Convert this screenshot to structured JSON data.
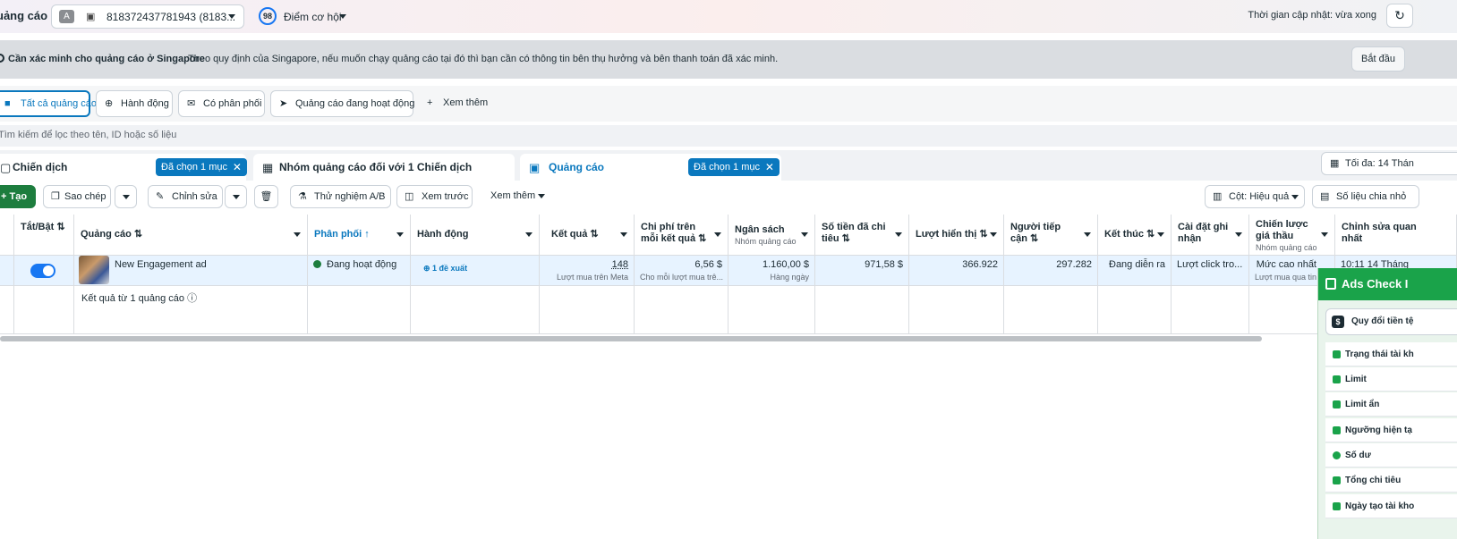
{
  "topbar": {
    "title": "uảng cáo",
    "account_badge": "A",
    "account_text": "818372437781943 (8183...",
    "opportunity_score": "98",
    "opportunity_label": "Điểm cơ hội",
    "updated": "Thời gian cập nhật: vừa xong"
  },
  "banner": {
    "title": "Cần xác minh cho quảng cáo ở Singapore",
    "text": "Theo quy định của Singapore, nếu muốn chạy quảng cáo tại đó thì bạn cần có thông tin bên thụ hưởng và bên thanh toán đã xác minh.",
    "button": "Bắt đầu"
  },
  "chips": [
    "Tất cả quảng cáo",
    "Hành động",
    "Có phân phối",
    "Quảng cáo đang hoạt động",
    "Xem thêm"
  ],
  "search": {
    "placeholder": "Tìm kiếm để lọc theo tên, ID hoặc số liệu"
  },
  "tabs": {
    "campaign": "Chiến dịch",
    "adset": "Nhóm quảng cáo đối với 1 Chiến dịch",
    "ad": "Quảng cáo",
    "selected": "Đã chọn 1 mục",
    "date": "Tối đa: 14 Thán"
  },
  "toolbar": {
    "create": "Tạo",
    "copy": "Sao chép",
    "edit": "Chỉnh sửa",
    "ab_test": "Thử nghiệm A/B",
    "preview": "Xem trước",
    "more": "Xem thêm",
    "columns": "Cột: Hiệu quả",
    "breakdown": "Số liệu chia nhỏ"
  },
  "table": {
    "headers": {
      "toggle": "Tắt/Bật ⇅",
      "ad": "Quảng cáo ⇅",
      "delivery": "Phân phối ↑",
      "actions": "Hành động",
      "results": "Kết quả ⇅",
      "cost": "Chi phí trên mỗi kết quả ⇅",
      "budget": "Ngân sách",
      "budget_sub": "Nhóm quảng cáo",
      "spent": "Số tiền đã chi tiêu ⇅",
      "impressions": "Lượt hiển thị ⇅",
      "reach": "Người tiếp cận ⇅",
      "end": "Kết thúc ⇅",
      "attribution": "Cài đặt ghi nhận",
      "bid": "Chiến lược giá thầu",
      "bid_sub": "Nhóm quảng cáo",
      "last_edit": "Chỉnh sửa quan nhất"
    },
    "row": {
      "ad_name": "New Engagement ad",
      "delivery": "Đang hoạt động",
      "actions": "1 đề xuất",
      "results": "148",
      "results_sub": "Lượt mua trên Meta",
      "cost": "6,56 $",
      "cost_sub": "Cho mỗi lượt mua trê...",
      "budget": "1.160,00 $",
      "budget_sub": "Hàng ngày",
      "spent": "971,58 $",
      "impressions": "366.922",
      "reach": "297.282",
      "end": "Đang diễn ra",
      "attribution": "Lượt click tro...",
      "bid": "Mức cao nhất",
      "bid_sub": "Lượt mua qua tin",
      "last_edit": "10:11 14 Tháng"
    },
    "summary": "Kết quả từ 1 quảng cáo"
  },
  "panel": {
    "title": "Ads Check I",
    "conversion": "Quy đổi tiền tệ",
    "rows": [
      "Trạng thái tài kh",
      "Limit",
      "Limit ẩn",
      "Ngưỡng hiện tạ",
      "Số dư",
      "Tổng chi tiêu",
      "Ngày tạo tài kho"
    ]
  }
}
